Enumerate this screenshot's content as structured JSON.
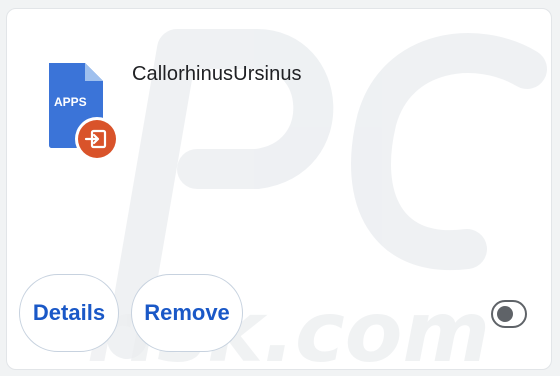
{
  "extension": {
    "name": "CallorhinusUrsinus",
    "icon_label": "APPS",
    "icon": "apps-document-icon",
    "badge_icon": "exit-arrow-icon",
    "colors": {
      "doc_blue": "#3b74d8",
      "doc_fold": "#9fc0ee",
      "badge_orange": "#d9532a"
    }
  },
  "actions": {
    "details_label": "Details",
    "remove_label": "Remove"
  },
  "toggle": {
    "enabled": false
  },
  "colors": {
    "accent": "#1a58c7",
    "button_border": "#c7d2df",
    "text": "#202124"
  }
}
